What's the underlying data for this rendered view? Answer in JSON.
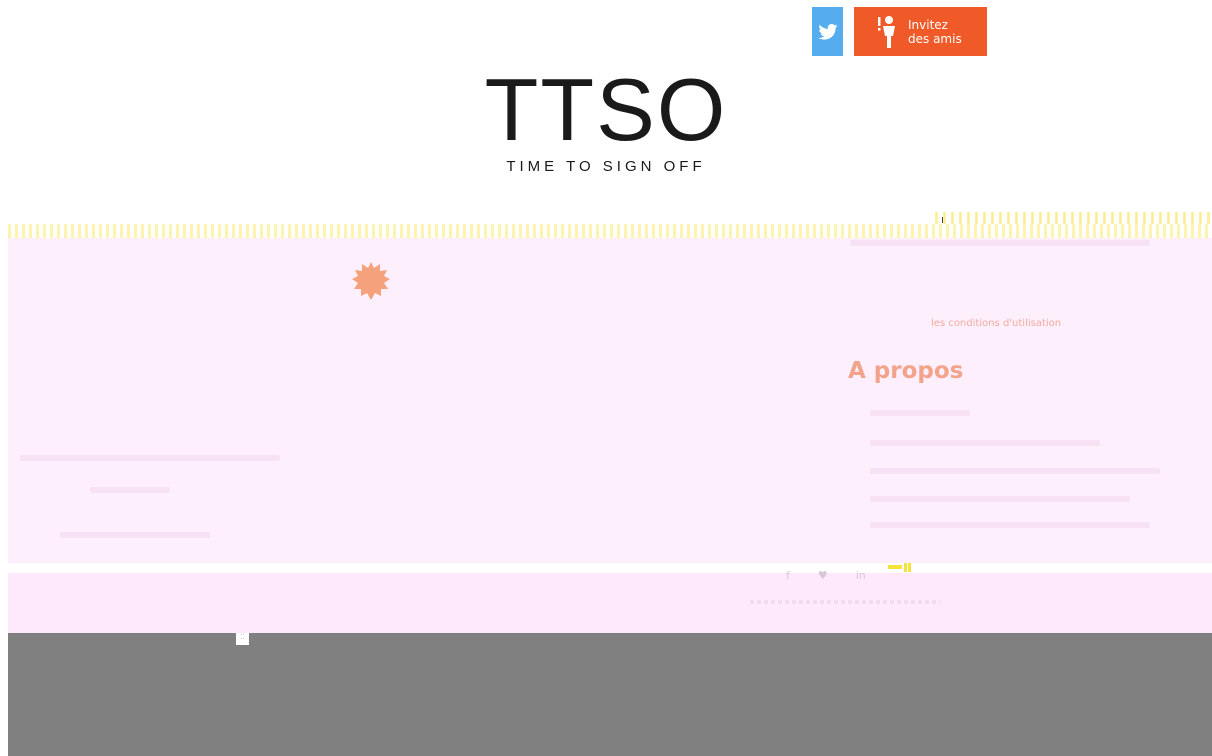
{
  "header": {
    "twitter_icon": "twitter-bird-icon",
    "invite_label_line1": "Invitez",
    "invite_label_line2": "des amis",
    "invite_icon": "person-exclamation-icon",
    "colors": {
      "twitter": "#55acee",
      "invite": "#f05a28"
    }
  },
  "logo": {
    "title": "TTSO",
    "subtitle": "TIME TO SIGN OFF"
  },
  "content": {
    "conditions_link": "les conditions d'utilisation",
    "about_heading": "A propos",
    "accent_color": "#f3a28b"
  },
  "footer": {
    "icons": [
      "facebook-icon",
      "twitter-icon",
      "linkedin-icon"
    ],
    "icon_glyphs": [
      "f",
      "♥",
      "in"
    ],
    "marks": "⁚⁚"
  }
}
